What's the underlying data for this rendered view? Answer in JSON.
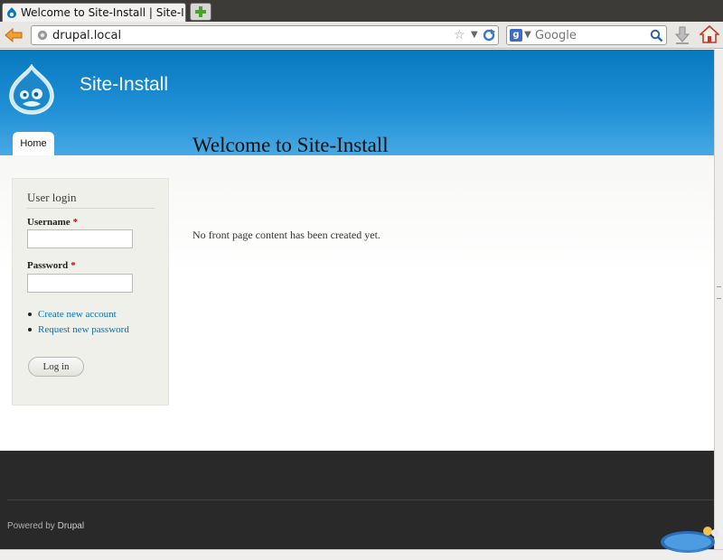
{
  "browser": {
    "tab_title": "Welcome to Site-Install | Site-I...",
    "url": "drupal.local",
    "search_placeholder": "Google"
  },
  "site": {
    "name": "Site-Install",
    "nav": [
      "Home"
    ]
  },
  "login_block": {
    "title": "User login",
    "username_label": "Username",
    "password_label": "Password",
    "required_marker": "*",
    "links": [
      "Create new account",
      "Request new password"
    ],
    "submit_label": "Log in"
  },
  "content": {
    "title": "Welcome to Site-Install",
    "body": "No front page content has been created yet."
  },
  "footer": {
    "prefix": "Powered by",
    "link": "Drupal"
  },
  "colors": {
    "header_blue": "#0779bf",
    "link_blue": "#0071b3",
    "required_red": "#cc0000",
    "footer_bg": "#292929"
  }
}
